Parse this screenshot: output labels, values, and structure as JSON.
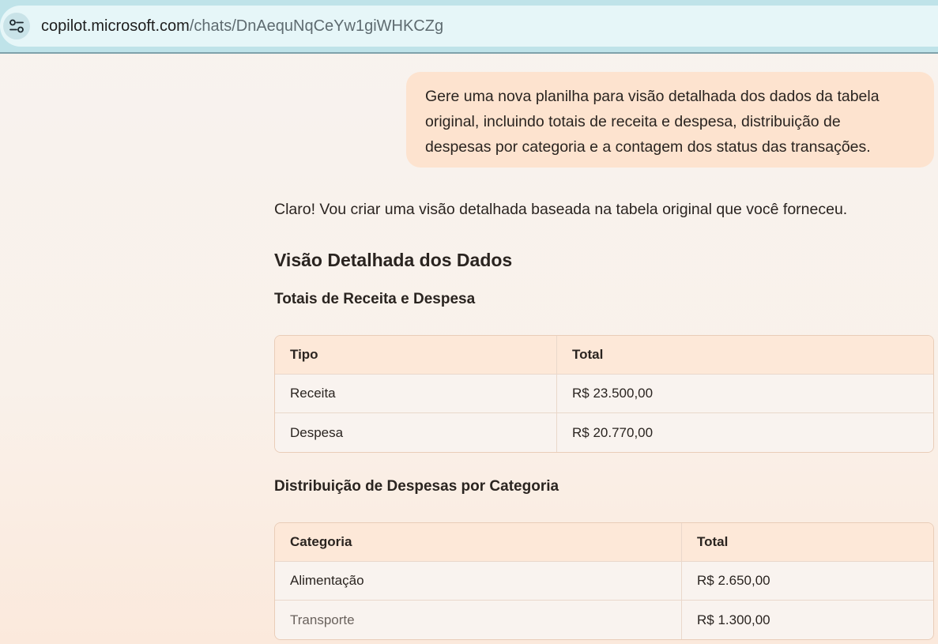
{
  "browser": {
    "url_host": "copilot.microsoft.com",
    "url_path": "/chats/DnAequNqCeYw1giWHKCZg",
    "site_icon": "tune-settings-icon"
  },
  "user_message": {
    "line1": "Gere uma nova planilha para visão detalhada dos dados da tabela",
    "line2": "original, incluindo totais de receita e despesa, distribuição de",
    "line3": "despesas por categoria e a contagem dos status das transações."
  },
  "response": {
    "intro": "Claro! Vou criar uma visão detalhada baseada na tabela original que você forneceu.",
    "heading": "Visão Detalhada dos Dados",
    "section1_title": "Totais de Receita e Despesa",
    "table1": {
      "headers": [
        "Tipo",
        "Total"
      ],
      "rows": [
        [
          "Receita",
          "R$ 23.500,00"
        ],
        [
          "Despesa",
          "R$ 20.770,00"
        ]
      ]
    },
    "section2_title": "Distribuição de Despesas por Categoria",
    "table2": {
      "headers": [
        "Categoria",
        "Total"
      ],
      "rows": [
        [
          "Alimentação",
          "R$ 2.650,00"
        ],
        [
          "Transporte",
          "R$ 1.300,00"
        ]
      ]
    }
  }
}
